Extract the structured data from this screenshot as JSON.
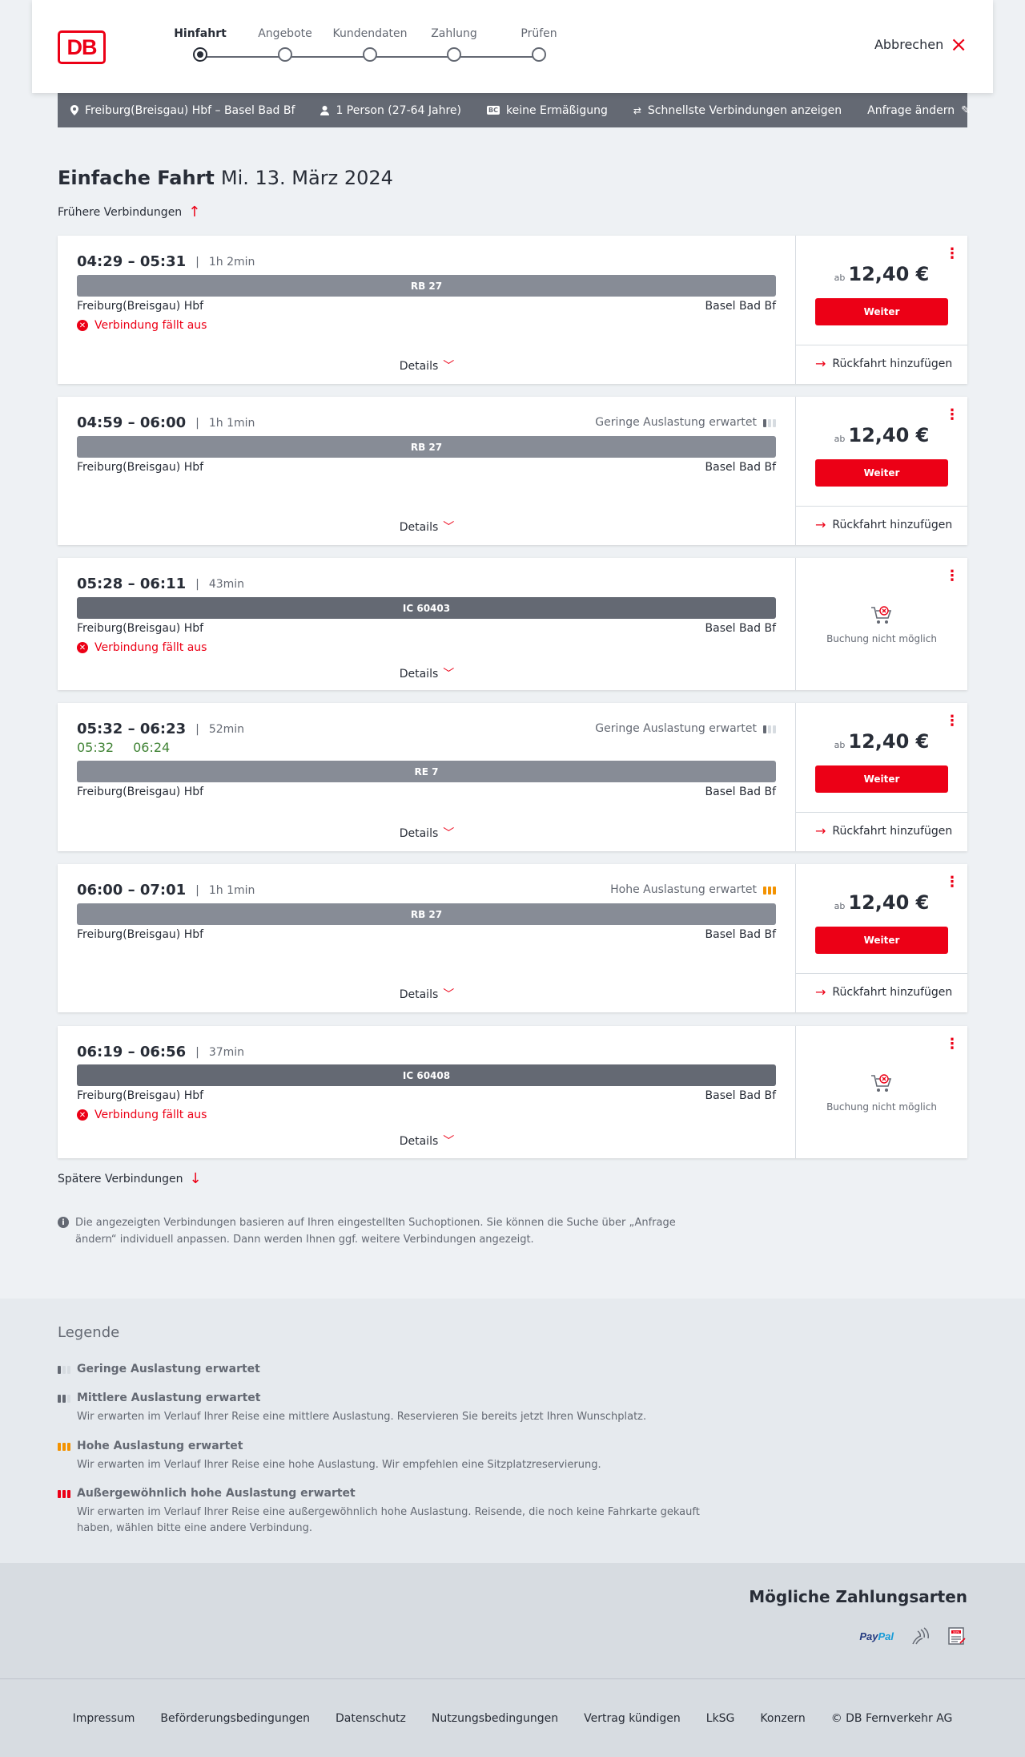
{
  "header": {
    "logo_text": "DB",
    "steps": [
      {
        "label": "Hinfahrt",
        "active": true
      },
      {
        "label": "Angebote",
        "active": false
      },
      {
        "label": "Kundendaten",
        "active": false
      },
      {
        "label": "Zahlung",
        "active": false
      },
      {
        "label": "Prüfen",
        "active": false
      }
    ],
    "cancel_label": "Abbrechen"
  },
  "summary": {
    "route": "Freiburg(Breisgau) Hbf – Basel Bad Bf",
    "persons": "1 Person (27-64 Jahre)",
    "discount": "keine Ermäßigung",
    "discount_badge": "BC",
    "option": "Schnellste Verbindungen anzeigen",
    "edit": "Anfrage ändern"
  },
  "main": {
    "title": "Einfache Fahrt",
    "date": "Mi. 13. März 2024",
    "earlier": "Frühere Verbindungen",
    "later": "Spätere Verbindungen",
    "info": "Die angezeigten Verbindungen basieren auf Ihren eingestellten Suchoptionen. Sie können die Suche über „Anfrage ändern“ individuell anpassen. Dann werden Ihnen ggf. weitere Verbindungen angezeigt."
  },
  "connections": [
    {
      "times": "04:29 – 05:31",
      "duration": "1h 2min",
      "train": "RB 27",
      "from": "Freiburg(Breisgau) Hbf",
      "to": "Basel Bad Bf",
      "cancelled": "Verbindung fällt aus",
      "details": "Details",
      "price_prefix": "ab",
      "price": "12,40 €",
      "button": "Weiter",
      "return": "Rückfahrt hinzufügen"
    },
    {
      "times": "04:59 – 06:00",
      "duration": "1h 1min",
      "occupancy": "Geringe Auslastung erwartet",
      "train": "RB 27",
      "from": "Freiburg(Breisgau) Hbf",
      "to": "Basel Bad Bf",
      "details": "Details",
      "price_prefix": "ab",
      "price": "12,40 €",
      "button": "Weiter",
      "return": "Rückfahrt hinzufügen"
    },
    {
      "times": "05:28 – 06:11",
      "duration": "43min",
      "train": "IC 60403",
      "from": "Freiburg(Breisgau) Hbf",
      "to": "Basel Bad Bf",
      "cancelled": "Verbindung fällt aus",
      "details": "Details",
      "nobook": "Buchung nicht möglich"
    },
    {
      "times": "05:32 – 06:23",
      "duration": "52min",
      "occupancy": "Geringe Auslastung erwartet",
      "rt_dep": "05:32",
      "rt_arr": "06:24",
      "train": "RE 7",
      "from": "Freiburg(Breisgau) Hbf",
      "to": "Basel Bad Bf",
      "details": "Details",
      "price_prefix": "ab",
      "price": "12,40 €",
      "button": "Weiter",
      "return": "Rückfahrt hinzufügen"
    },
    {
      "times": "06:00 – 07:01",
      "duration": "1h 1min",
      "occupancy": "Hohe Auslastung erwartet",
      "train": "RB 27",
      "from": "Freiburg(Breisgau) Hbf",
      "to": "Basel Bad Bf",
      "details": "Details",
      "price_prefix": "ab",
      "price": "12,40 €",
      "button": "Weiter",
      "return": "Rückfahrt hinzufügen"
    },
    {
      "times": "06:19 – 06:56",
      "duration": "37min",
      "train": "IC 60408",
      "from": "Freiburg(Breisgau) Hbf",
      "to": "Basel Bad Bf",
      "cancelled": "Verbindung fällt aus",
      "details": "Details",
      "nobook": "Buchung nicht möglich"
    }
  ],
  "legend": {
    "title": "Legende",
    "items": [
      {
        "title": "Geringe Auslastung erwartet",
        "desc": ""
      },
      {
        "title": "Mittlere Auslastung erwartet",
        "desc": "Wir erwarten im Verlauf Ihrer Reise eine mittlere Auslastung. Reservieren Sie bereits jetzt Ihren Wunschplatz."
      },
      {
        "title": "Hohe Auslastung erwartet",
        "desc": "Wir erwarten im Verlauf Ihrer Reise eine hohe Auslastung. Wir empfehlen eine Sitzplatzreservierung."
      },
      {
        "title": "Außergewöhnlich hohe Auslastung erwartet",
        "desc": "Wir erwarten im Verlauf Ihrer Reise eine außergewöhnlich hohe Auslastung. Reisende, die noch keine Fahrkarte gekauft haben, wählen bitte eine andere Verbindung."
      }
    ]
  },
  "payment": {
    "title": "Mögliche Zahlungsarten",
    "paypal_a": "Pay",
    "paypal_b": "Pal",
    "sepa_label": "SEPA"
  },
  "footer": {
    "links": [
      "Impressum",
      "Beförderungsbedingungen",
      "Datenschutz",
      "Nutzungsbedingungen",
      "Vertrag kündigen",
      "LkSG",
      "Konzern",
      "© DB Fernverkehr AG"
    ]
  },
  "colors": {
    "brand_red": "#ec0016",
    "bar_grey": "#878c96",
    "bar_dark": "#646973",
    "realtime_green": "#408335",
    "high_occupancy": "#f39200"
  }
}
